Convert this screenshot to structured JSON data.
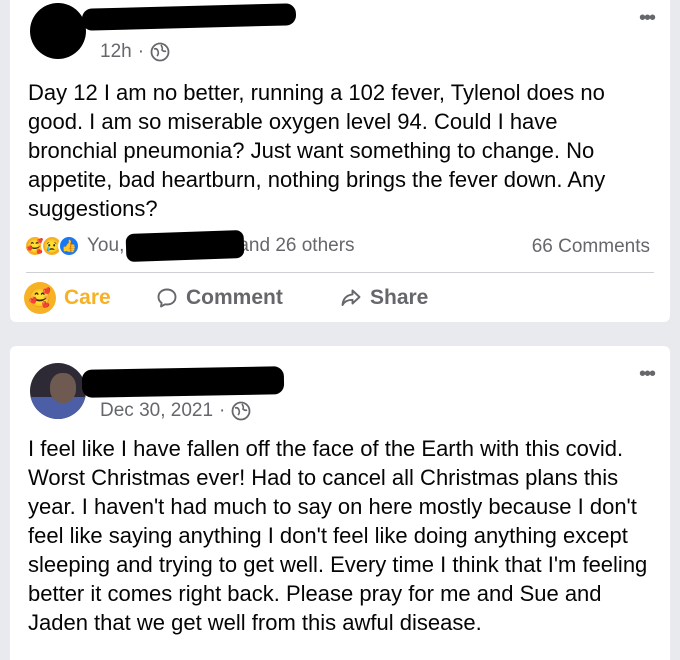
{
  "posts": [
    {
      "time": "12h",
      "separator": "·",
      "text": "Day 12 I am no better, running a 102 fever, Tylenol does no good. I am so miserable oxygen level 94. Could I have bronchial pneumonia? Just want something to change. No appetite, bad heartburn, nothing brings the fever down. Any suggestions?",
      "reactions_prefix": "You,",
      "reactions_suffix": "and 26 others",
      "comments": "66 Comments",
      "reaction_icons": [
        "care-icon",
        "sad-icon",
        "like-icon"
      ],
      "actions": {
        "care": "Care",
        "comment": "Comment",
        "share": "Share"
      },
      "more": "•••"
    },
    {
      "time": "Dec 30, 2021",
      "separator": "·",
      "text": "I feel like I have fallen off the face of the Earth with this covid. Worst Christmas ever! Had to cancel all Christmas plans this year. I haven't had much to say on here mostly because I don't feel like saying anything I don't feel like doing anything except sleeping and trying to get well. Every time I think that I'm feeling better it comes right back. Please pray for me and Sue and Jaden that we get well from this awful disease.",
      "more": "•••"
    }
  ],
  "colors": {
    "background": "#e9eaee",
    "card": "#ffffff",
    "secondary_text": "#65676b",
    "care_yellow": "#f7b125",
    "like_blue": "#1877f2"
  }
}
